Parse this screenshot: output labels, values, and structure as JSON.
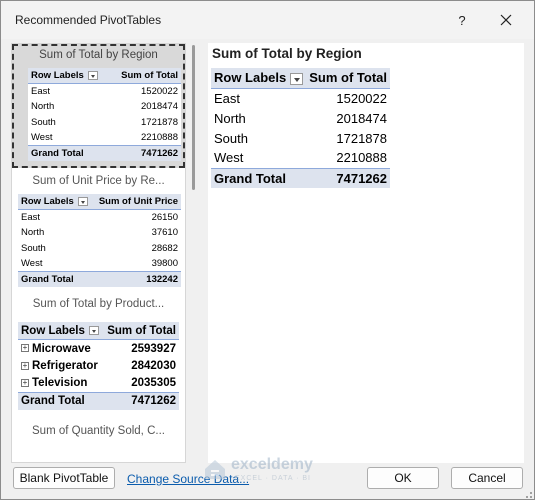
{
  "window": {
    "title": "Recommended PivotTables",
    "help_label": "?"
  },
  "recommendations": [
    {
      "label": "Sum of Total by Region",
      "header": [
        "Row Labels",
        "Sum of Total"
      ],
      "rows": [
        [
          "East",
          "1520022"
        ],
        [
          "North",
          "2018474"
        ],
        [
          "South",
          "1721878"
        ],
        [
          "West",
          "2210888"
        ]
      ],
      "total": [
        "Grand Total",
        "7471262"
      ]
    },
    {
      "label": "Sum of Unit Price by Re...",
      "header": [
        "Row Labels",
        "Sum of Unit Price"
      ],
      "rows": [
        [
          "East",
          "26150"
        ],
        [
          "North",
          "37610"
        ],
        [
          "South",
          "28682"
        ],
        [
          "West",
          "39800"
        ]
      ],
      "total": [
        "Grand Total",
        "132242"
      ]
    },
    {
      "label": "Sum of Total by Product...",
      "header": [
        "Row Labels",
        "Sum of Total"
      ],
      "rows": [
        [
          "Microwave",
          "2593927"
        ],
        [
          "Refrigerator",
          "2842030"
        ],
        [
          "Television",
          "2035305"
        ]
      ],
      "total": [
        "Grand Total",
        "7471262"
      ]
    },
    {
      "label": "Sum of Quantity Sold, C..."
    }
  ],
  "preview": {
    "title": "Sum of Total by Region",
    "header": [
      "Row Labels",
      "Sum of Total"
    ],
    "rows": [
      [
        "East",
        "1520022"
      ],
      [
        "North",
        "2018474"
      ],
      [
        "South",
        "1721878"
      ],
      [
        "West",
        "2210888"
      ]
    ],
    "total": [
      "Grand Total",
      "7471262"
    ]
  },
  "footer": {
    "blank_button": "Blank PivotTable",
    "change_source_link": "Change Source Data...",
    "ok_button": "OK",
    "cancel_button": "Cancel"
  },
  "watermark": {
    "name": "exceldemy",
    "tagline": "EXCEL · DATA · BI"
  }
}
